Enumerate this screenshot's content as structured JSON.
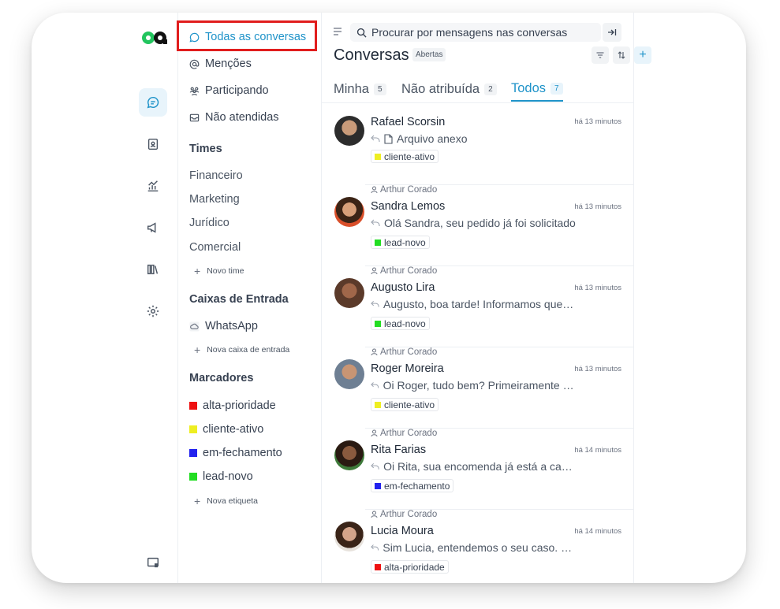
{
  "sidebar": {
    "nav": [
      {
        "label": "Todas as conversas",
        "icon": "chat-icon"
      },
      {
        "label": "Menções",
        "icon": "at-icon"
      },
      {
        "label": "Participando",
        "icon": "group-icon"
      },
      {
        "label": "Não atendidas",
        "icon": "inbox-icon"
      }
    ],
    "teams_heading": "Times",
    "teams": [
      "Financeiro",
      "Marketing",
      "Jurídico",
      "Comercial"
    ],
    "new_team": "Novo time",
    "inboxes_heading": "Caixas de Entrada",
    "inboxes": [
      {
        "label": "WhatsApp"
      }
    ],
    "new_inbox": "Nova caixa de entrada",
    "labels_heading": "Marcadores",
    "labels": [
      {
        "label": "alta-prioridade",
        "color": "#ee1111"
      },
      {
        "label": "cliente-ativo",
        "color": "#eeee22"
      },
      {
        "label": "em-fechamento",
        "color": "#2222ee"
      },
      {
        "label": "lead-novo",
        "color": "#22dd22"
      }
    ],
    "new_label": "Nova etiqueta"
  },
  "conversations": {
    "search_placeholder": "Procurar por mensagens nas conversas",
    "title": "Conversas",
    "status": "Abertas",
    "tabs": [
      {
        "label": "Minha",
        "count": "5"
      },
      {
        "label": "Não atribuída",
        "count": "2"
      },
      {
        "label": "Todos",
        "count": "7"
      }
    ],
    "items": [
      {
        "agent": "",
        "name": "Rafael Scorsin",
        "time": "há 13 minutos",
        "message": "Arquivo anexo",
        "attachment": true,
        "label": "cliente-ativo",
        "label_color": "#eeee22"
      },
      {
        "agent": "Arthur Corado",
        "name": "Sandra Lemos",
        "time": "há 13 minutos",
        "message": "Olá Sandra, seu pedido já foi solicitado",
        "label": "lead-novo",
        "label_color": "#22dd22"
      },
      {
        "agent": "Arthur Corado",
        "name": "Augusto Lira",
        "time": "há 13 minutos",
        "message": "Augusto, boa tarde! Informamos que o seu",
        "label": "lead-novo",
        "label_color": "#22dd22"
      },
      {
        "agent": "Arthur Corado",
        "name": "Roger Moreira",
        "time": "há 13 minutos",
        "message": "Oi Roger, tudo bem? Primeiramente gostaria",
        "label": "cliente-ativo",
        "label_color": "#eeee22"
      },
      {
        "agent": "Arthur Corado",
        "name": "Rita Farias",
        "time": "há 14 minutos",
        "message": "Oi Rita, sua encomenda já está a caminho",
        "label": "em-fechamento",
        "label_color": "#2222ee"
      },
      {
        "agent": "Arthur Corado",
        "name": "Lucia Moura",
        "time": "há 14 minutos",
        "message": "Sim Lucia, entendemos o seu caso. Por favor",
        "label": "alta-prioridade",
        "label_color": "#ee1111"
      }
    ]
  },
  "colors": {
    "accent": "#1f93c9",
    "highlight": "#e11d1d",
    "logo_green": "#22c55e"
  }
}
